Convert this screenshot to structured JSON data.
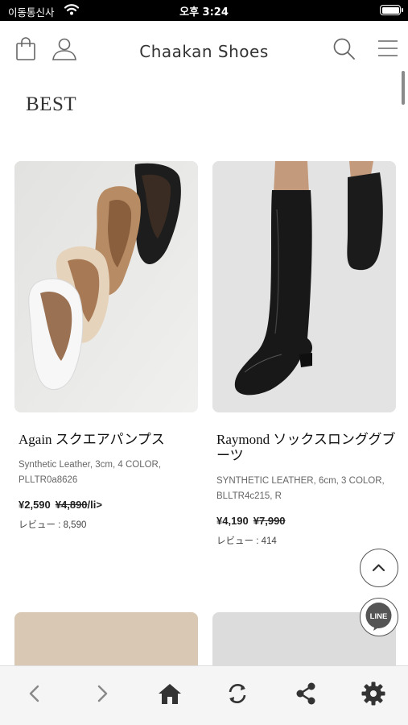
{
  "status_bar": {
    "carrier": "이동통신사",
    "time": "오후 3:24"
  },
  "header": {
    "title": "Chaakan Shoes"
  },
  "section": {
    "title": "BEST"
  },
  "products": [
    {
      "name": "Again スクエアパンプス",
      "desc_line1": "Synthetic Leather, 3cm, 4 COLOR,",
      "desc_line2": "PLLTR0a8626",
      "price": "¥2,590",
      "original_price": "¥4,890",
      "price_suffix": "/li>",
      "reviews": "レビュー : 8,590"
    },
    {
      "name_line1": "Raymond ソックスロンググブ",
      "name_line2": "ーツ",
      "desc_line1": "SYNTHETIC LEATHER, 6cm, 3 COLOR,",
      "desc_line2": "BLLTR4c215, R",
      "price": "¥4,190",
      "original_price": "¥7,990",
      "reviews": "レビュー : 414"
    }
  ],
  "fab": {
    "line_label": "LINE"
  },
  "colors": {
    "status_bar": "#000000",
    "text": "#222222",
    "bottom_bar": "#f5f5f5"
  },
  "icons": [
    "wifi-icon",
    "battery-icon",
    "shopping-bag-icon",
    "user-icon",
    "search-icon",
    "menu-icon",
    "chevron-up-icon",
    "line-icon",
    "back-icon",
    "forward-icon",
    "home-icon",
    "refresh-icon",
    "share-icon",
    "settings-icon"
  ]
}
